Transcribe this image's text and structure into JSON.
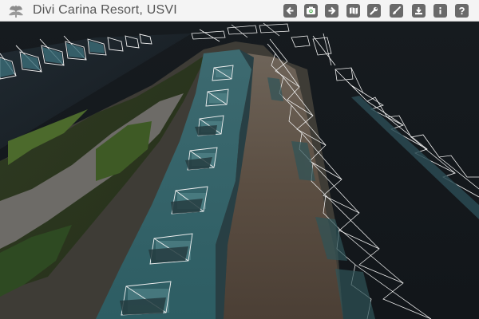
{
  "app": {
    "title": "Divi Carina Resort, USVI"
  },
  "toolbar": [
    {
      "id": "back",
      "icon": "arrow-left-icon",
      "active": false
    },
    {
      "id": "camera",
      "icon": "camera-icon",
      "active": true
    },
    {
      "id": "forward",
      "icon": "arrow-right-icon",
      "active": false
    },
    {
      "id": "map",
      "icon": "map-icon",
      "active": false
    },
    {
      "id": "tools",
      "icon": "wrench-icon",
      "active": false
    },
    {
      "id": "measure",
      "icon": "brush-icon",
      "active": false
    },
    {
      "id": "download",
      "icon": "download-icon",
      "active": false
    },
    {
      "id": "info",
      "icon": "info-icon",
      "active": false
    },
    {
      "id": "help",
      "icon": "help-icon",
      "active": false
    }
  ],
  "colors": {
    "toolbar_bg": "#f4f4f4",
    "button_bg": "#6a6a6a",
    "button_active": "#4caf50",
    "title_text": "#555555",
    "ocean": "#14191e",
    "camera_frustum": "#f2f2f2"
  }
}
